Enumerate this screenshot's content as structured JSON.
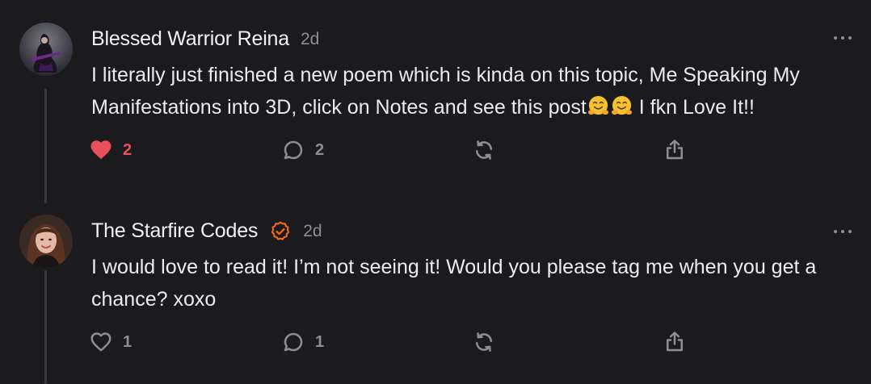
{
  "comments": [
    {
      "author": "Blessed Warrior Reina",
      "time": "2d",
      "verified": false,
      "text_before_emoji": "I literally just finished a new poem which is kinda on this topic, Me Speaking My Manifestations into 3D, click on Notes and see this post",
      "emojis": [
        "hugging-face-emoji",
        "hugging-face-emoji"
      ],
      "text_after_emoji": " I fkn Love It!!",
      "likes": "2",
      "liked": true,
      "replies": "2"
    },
    {
      "author": "The Starfire Codes",
      "time": "2d",
      "verified": true,
      "text": "I would love to read it! I’m not seeing it! Would you please tag me when you get a chance? xoxo",
      "likes": "1",
      "liked": false,
      "replies": "1"
    }
  ],
  "colors": {
    "background": "#1b1b1d",
    "text": "#ececef",
    "muted": "#8e8e93",
    "like_active": "#e8505b",
    "verified_badge": "#ff6a1a"
  },
  "icons": {
    "like": "heart-icon",
    "reply": "comment-bubble-icon",
    "restack": "restack-icon",
    "share": "share-icon",
    "more": "more-options-icon",
    "verified": "verified-check-icon"
  }
}
